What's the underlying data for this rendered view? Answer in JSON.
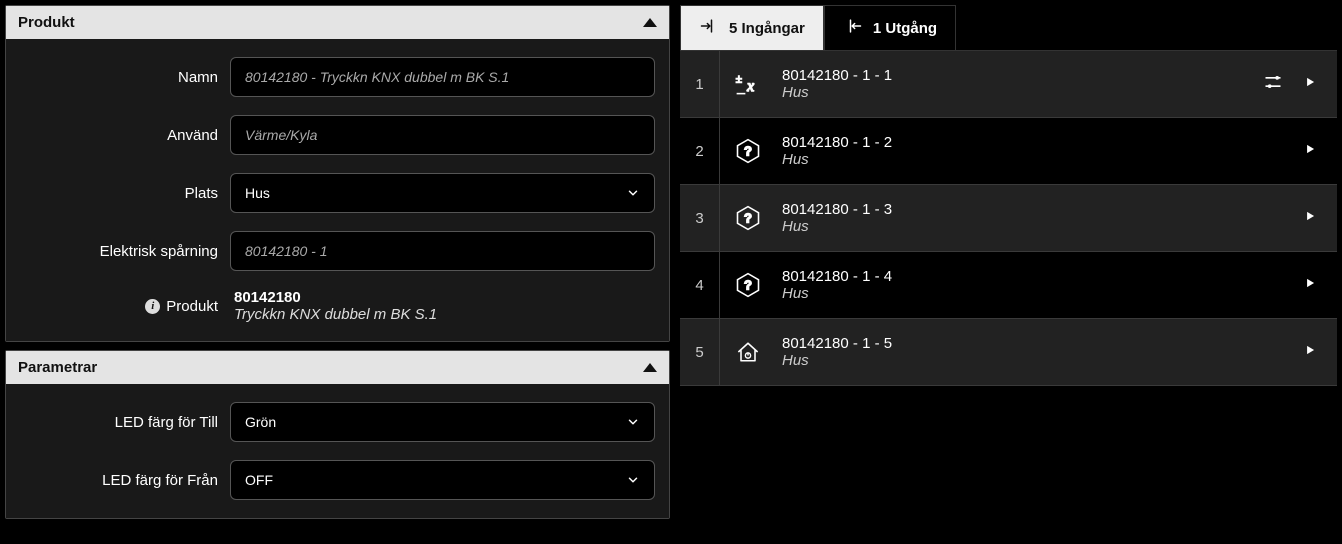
{
  "product_panel": {
    "header": "Produkt",
    "fields": {
      "name_label": "Namn",
      "name_value": "80142180 - Tryckkn KNX dubbel m BK S.1",
      "use_label": "Använd",
      "use_value": "Värme/Kyla",
      "place_label": "Plats",
      "place_value": "Hus",
      "tracking_label": "Elektrisk spårning",
      "tracking_value": "80142180 - 1",
      "product_label": "Produkt",
      "product_id": "80142180",
      "product_desc": "Tryckkn KNX dubbel m BK S.1"
    }
  },
  "params_panel": {
    "header": "Parametrar",
    "fields": {
      "led_on_label": "LED färg för Till",
      "led_on_value": "Grön",
      "led_off_label": "LED färg för Från",
      "led_off_value": "OFF"
    }
  },
  "tabs": {
    "inputs": "5 Ingångar",
    "outputs": "1 Utgång"
  },
  "inputs": [
    {
      "num": "1",
      "title": "80142180 - 1 - 1",
      "sub": "Hus",
      "icon": "var",
      "settings": true
    },
    {
      "num": "2",
      "title": "80142180 - 1 - 2",
      "sub": "Hus",
      "icon": "question",
      "settings": false
    },
    {
      "num": "3",
      "title": "80142180 - 1 - 3",
      "sub": "Hus",
      "icon": "question",
      "settings": false
    },
    {
      "num": "4",
      "title": "80142180 - 1 - 4",
      "sub": "Hus",
      "icon": "question",
      "settings": false
    },
    {
      "num": "5",
      "title": "80142180 - 1 - 5",
      "sub": "Hus",
      "icon": "house",
      "settings": false
    }
  ]
}
